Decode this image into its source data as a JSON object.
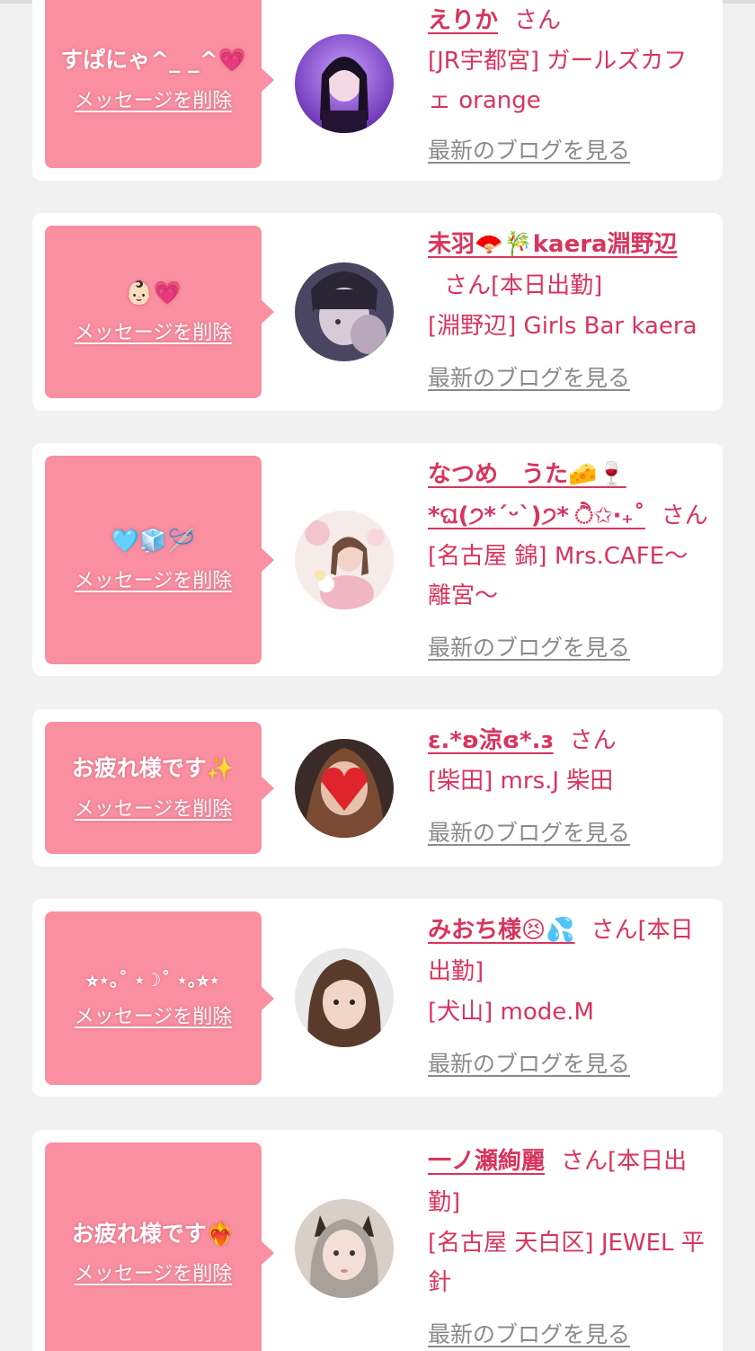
{
  "delete_label": "メッセージを削除",
  "blog_label": "最新のブログを見る",
  "san_label": "さん",
  "entries": [
    {
      "message": "すぱにゃ^_ _^💗",
      "name": "えりか",
      "suffix": "",
      "shop": "[JR宇都宮] ガールズカフェ orange"
    },
    {
      "message": "👶🏻💗",
      "name": "未羽🪭🎋kaera淵野辺",
      "suffix": "[本日出勤]",
      "shop": "[淵野辺] Girls Bar kaera"
    },
    {
      "message": "🩵🧊🪡",
      "name": "なつめ　うた🧀🍷*ଘ(੭*ˊᵕˋ)੭* ੈ✩‧₊˚",
      "suffix": "",
      "shop": "[名古屋 錦] Mrs.CAFE〜離宮〜"
    },
    {
      "message": "お疲れ様です✨",
      "name": "ε.*ʚ涼ɞ*.ɜ",
      "suffix": "",
      "shop": "[柴田] mrs.J 柴田"
    },
    {
      "message": "⭐︎⋆｡˚ ⋆☽˚ ⋆｡⭐︎⋆",
      "name": "みおち様😣💦",
      "suffix": "[本日出勤]",
      "shop": "[犬山] mode.M"
    },
    {
      "message": "お疲れ様です❤️‍🔥",
      "name": "一ノ瀬絢麗",
      "suffix": "[本日出勤]",
      "shop": "[名古屋 天白区] JEWEL 平針"
    }
  ],
  "colors": {
    "accent": "#d9345d",
    "bubble": "#f98fa1",
    "background": "#f1f1f1",
    "card": "#ffffff",
    "link_gray": "#8a8a8a"
  }
}
